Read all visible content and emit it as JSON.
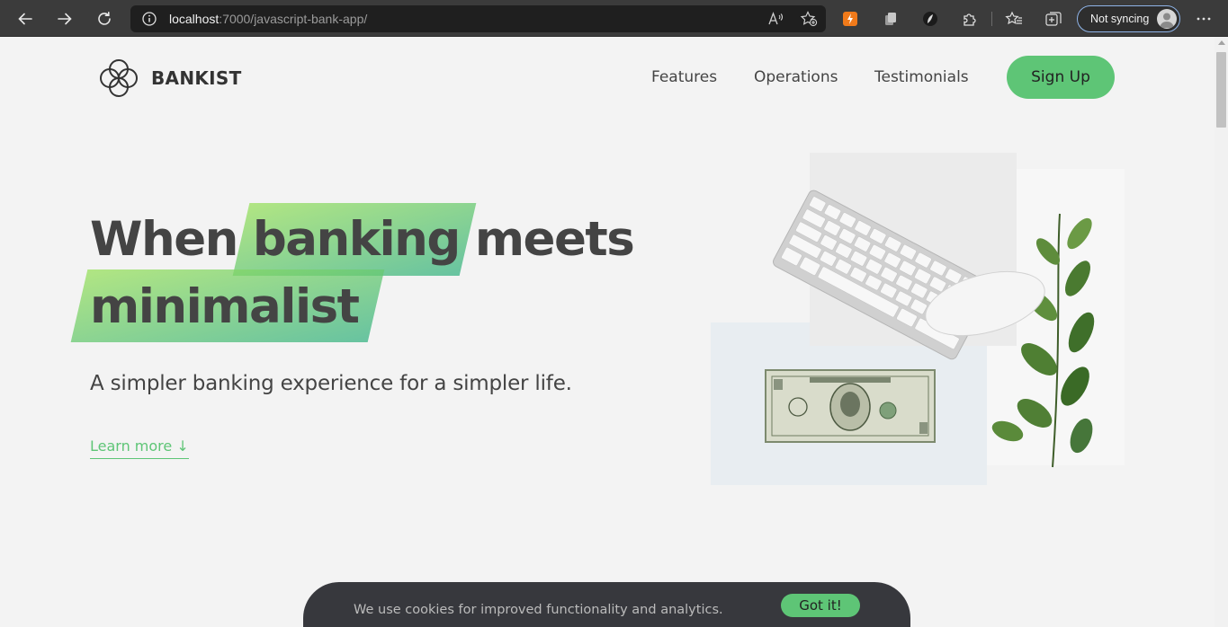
{
  "browser": {
    "url_host": "localhost",
    "url_path": ":7000/javascript-bank-app/",
    "sync_label": "Not syncing",
    "icons": {
      "back": "arrow-left-icon",
      "forward": "arrow-right-icon",
      "reload": "reload-icon",
      "info": "info-icon",
      "read_aloud": "read-aloud-icon",
      "favorite_add": "star-add-icon",
      "extension_1": "lightning-extension-icon",
      "extension_2": "copy-extension-icon",
      "extension_3": "leaf-extension-icon",
      "extensions": "puzzle-icon",
      "favorites": "favorites-icon",
      "collections": "collections-icon",
      "avatar": "avatar-icon",
      "more": "more-dots-icon"
    }
  },
  "header": {
    "logo_text": "BANKIST",
    "nav": [
      "Features",
      "Operations",
      "Testimonials"
    ],
    "signup_label": "Sign Up"
  },
  "hero": {
    "line1_word1": "When",
    "line1_word2": "banking",
    "line1_word3": "meets",
    "line2_word1": "minimalist",
    "subtitle": "A simpler banking experience for a simpler life.",
    "learn_more": "Learn more ↓"
  },
  "cookie": {
    "message": "We use cookies for improved functionality and analytics.",
    "button": "Got it!"
  },
  "colors": {
    "accent": "#5ec576",
    "chrome_bg": "#3b3b3b",
    "page_bg": "#f3f3f3",
    "text": "#444444",
    "cookie_bg": "#37383d"
  }
}
